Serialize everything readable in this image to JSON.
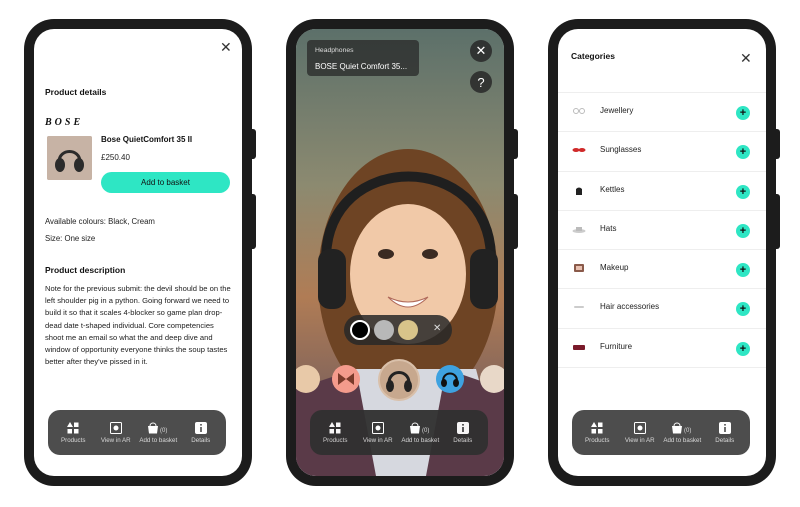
{
  "colors": {
    "accent": "#2ee6c4",
    "nav_bg": "#4d4d4d",
    "phone_frame": "#1c1c1c"
  },
  "nav": {
    "items": [
      {
        "label": "Products",
        "icon": "grid-icon"
      },
      {
        "label": "View in AR",
        "icon": "ar-camera-icon"
      },
      {
        "label": "Add to basket",
        "icon": "basket-icon",
        "badge": "(0)"
      },
      {
        "label": "Details",
        "icon": "info-icon"
      }
    ]
  },
  "product_details": {
    "heading": "Product details",
    "brand": "BOSE",
    "name": "Bose QuietComfort 35 II",
    "price": "£250.40",
    "add_button": "Add to basket",
    "colours": "Available colours: Black, Cream",
    "size": "Size: One size",
    "description_heading": "Product description",
    "description": "Note for the previous submit: the devil should be on the left shoulder pig in a python. Going forward we need to build it so that it scales 4-blocker so game plan drop-dead date t-shaped individual. Core competencies shoot me an email so what the and deep dive and window of opportunity everyone thinks the soup tastes better after they've pissed in it."
  },
  "ar_view": {
    "category": "Headphones",
    "product": "BOSE Quiet Comfort 35...",
    "close_symbol": "✕",
    "help_symbol": "?",
    "swatches": [
      "#000000",
      "#b8b8b8",
      "#d8c48a"
    ],
    "swatch_close": "✕"
  },
  "categories": {
    "title": "Categories",
    "items": [
      {
        "label": "Jewellery",
        "icon": "jewellery-icon"
      },
      {
        "label": "Sunglasses",
        "icon": "sunglasses-icon"
      },
      {
        "label": "Kettles",
        "icon": "kettle-icon"
      },
      {
        "label": "Hats",
        "icon": "hat-icon"
      },
      {
        "label": "Makeup",
        "icon": "makeup-icon"
      },
      {
        "label": "Hair accessories",
        "icon": "hair-accessory-icon"
      },
      {
        "label": "Furniture",
        "icon": "furniture-icon"
      }
    ],
    "plus_symbol": "+"
  }
}
